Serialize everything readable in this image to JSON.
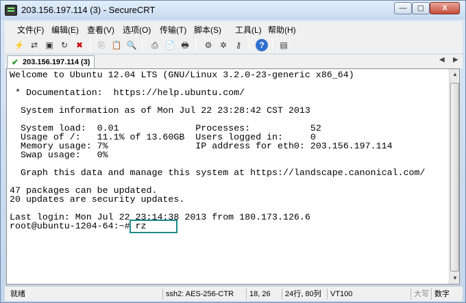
{
  "window": {
    "title": "203.156.197.114 (3) - SecureCRT",
    "controls": [
      "—",
      "▢",
      "X"
    ]
  },
  "menubar": [
    "文件(F)",
    "编辑(E)",
    "查看(V)",
    "选项(O)",
    "传输(T)",
    "脚本(S)",
    "工具(L)",
    "帮助(H)"
  ],
  "toolbar": {
    "icons": [
      {
        "name": "connect-icon",
        "glyph": "⚡"
      },
      {
        "name": "quick-connect-icon",
        "glyph": "⇄"
      },
      {
        "name": "connect-tab-icon",
        "glyph": "▣"
      },
      {
        "name": "reconnect-icon",
        "glyph": "↻"
      },
      {
        "name": "disconnect-icon",
        "glyph": "✖"
      },
      {
        "name": "copy-icon",
        "glyph": "⎘"
      },
      {
        "name": "paste-icon",
        "glyph": "📋"
      },
      {
        "name": "find-icon",
        "glyph": "🔍"
      },
      {
        "name": "print-setup-icon",
        "glyph": "⎙"
      },
      {
        "name": "log-session-icon",
        "glyph": "📄"
      },
      {
        "name": "print-icon",
        "glyph": "🖶"
      },
      {
        "name": "session-options-icon",
        "glyph": "⚙"
      },
      {
        "name": "settings-icon",
        "glyph": "✲"
      },
      {
        "name": "key-icon",
        "glyph": "⚷"
      },
      {
        "name": "help-icon",
        "glyph": "?"
      },
      {
        "name": "sftp-icon",
        "glyph": "▤"
      }
    ]
  },
  "tab": {
    "label": "203.156.197.114 (3)",
    "status_icon": "✔"
  },
  "terminal": {
    "lines": [
      "Welcome to Ubuntu 12.04 LTS (GNU/Linux 3.2.0-23-generic x86_64)",
      "",
      " * Documentation:  https://help.ubuntu.com/",
      "",
      "  System information as of Mon Jul 22 23:28:42 CST 2013",
      "",
      "  System load:  0.01              Processes:           52",
      "  Usage of /:   11.1% of 13.60GB  Users logged in:     0",
      "  Memory usage: 7%                IP address for eth0: 203.156.197.114",
      "  Swap usage:   0%",
      "",
      "  Graph this data and manage this system at https://landscape.canonical.com/",
      "",
      "47 packages can be updated.",
      "20 updates are security updates.",
      "",
      "Last login: Mon Jul 22 23:14:38 2013 from 180.173.126.6",
      "root@ubuntu-1204-64:~# rz"
    ]
  },
  "statusbar": {
    "ready": "就绪",
    "protocol": "ssh2: AES-256-CTR",
    "cursor": "18,  26",
    "size": "24行, 80列",
    "terminal_type": "VT100",
    "caps": "大写",
    "num": "数字"
  }
}
